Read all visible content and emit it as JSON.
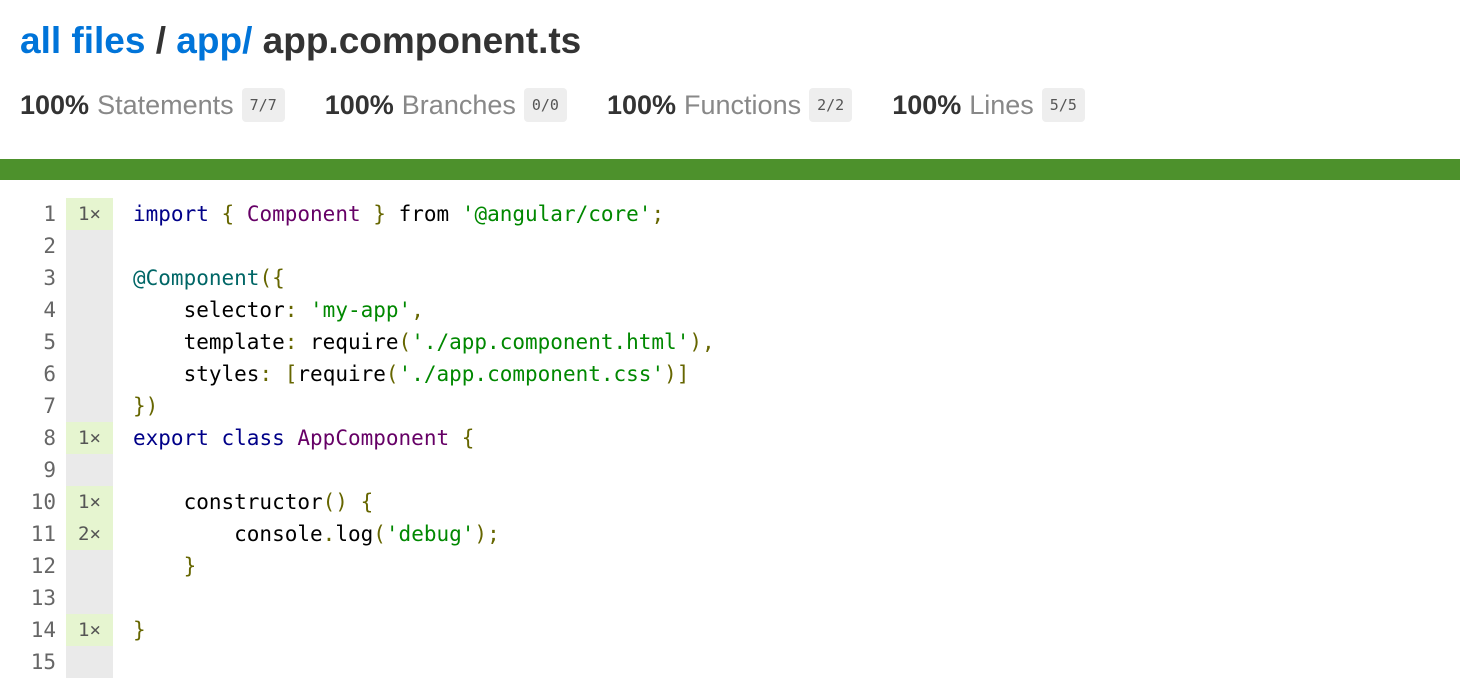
{
  "breadcrumb": {
    "root_link": "all files",
    "separator": "/",
    "folder_link": "app/",
    "file_name": "app.component.ts"
  },
  "stats": [
    {
      "pct": "100%",
      "label": "Statements",
      "fraction": "7/7"
    },
    {
      "pct": "100%",
      "label": "Branches",
      "fraction": "0/0"
    },
    {
      "pct": "100%",
      "label": "Functions",
      "fraction": "2/2"
    },
    {
      "pct": "100%",
      "label": "Lines",
      "fraction": "5/5"
    }
  ],
  "coverage_color": "#4d912c",
  "code_lines": [
    {
      "num": "1",
      "count": "1×",
      "tokens": [
        [
          "kw",
          "import"
        ],
        [
          "id",
          " "
        ],
        [
          "pun",
          "{"
        ],
        [
          "id",
          " "
        ],
        [
          "cls",
          "Component"
        ],
        [
          "id",
          " "
        ],
        [
          "pun",
          "}"
        ],
        [
          "id",
          " from "
        ],
        [
          "str",
          "'@angular/core'"
        ],
        [
          "pun",
          ";"
        ]
      ]
    },
    {
      "num": "2",
      "count": "",
      "tokens": []
    },
    {
      "num": "3",
      "count": "",
      "tokens": [
        [
          "dec",
          "@Component"
        ],
        [
          "pun",
          "({"
        ]
      ]
    },
    {
      "num": "4",
      "count": "",
      "tokens": [
        [
          "id",
          "    selector"
        ],
        [
          "pun",
          ":"
        ],
        [
          "id",
          " "
        ],
        [
          "str",
          "'my-app'"
        ],
        [
          "pun",
          ","
        ]
      ]
    },
    {
      "num": "5",
      "count": "",
      "tokens": [
        [
          "id",
          "    template"
        ],
        [
          "pun",
          ":"
        ],
        [
          "id",
          " require"
        ],
        [
          "pun",
          "("
        ],
        [
          "str",
          "'./app.component.html'"
        ],
        [
          "pun",
          "),"
        ]
      ]
    },
    {
      "num": "6",
      "count": "",
      "tokens": [
        [
          "id",
          "    styles"
        ],
        [
          "pun",
          ":"
        ],
        [
          "id",
          " "
        ],
        [
          "pun",
          "["
        ],
        [
          "id",
          "require"
        ],
        [
          "pun",
          "("
        ],
        [
          "str",
          "'./app.component.css'"
        ],
        [
          "pun",
          ")]"
        ]
      ]
    },
    {
      "num": "7",
      "count": "",
      "tokens": [
        [
          "pun",
          "})"
        ]
      ]
    },
    {
      "num": "8",
      "count": "1×",
      "tokens": [
        [
          "kw",
          "export"
        ],
        [
          "id",
          " "
        ],
        [
          "kw",
          "class"
        ],
        [
          "id",
          " "
        ],
        [
          "cls",
          "AppComponent"
        ],
        [
          "id",
          " "
        ],
        [
          "pun",
          "{"
        ]
      ]
    },
    {
      "num": "9",
      "count": "",
      "tokens": []
    },
    {
      "num": "10",
      "count": "1×",
      "tokens": [
        [
          "id",
          "    constructor"
        ],
        [
          "pun",
          "()"
        ],
        [
          "id",
          " "
        ],
        [
          "pun",
          "{"
        ]
      ]
    },
    {
      "num": "11",
      "count": "2×",
      "tokens": [
        [
          "id",
          "        console"
        ],
        [
          "pun",
          "."
        ],
        [
          "id",
          "log"
        ],
        [
          "pun",
          "("
        ],
        [
          "str",
          "'debug'"
        ],
        [
          "pun",
          ");"
        ]
      ]
    },
    {
      "num": "12",
      "count": "",
      "tokens": [
        [
          "id",
          "    "
        ],
        [
          "pun",
          "}"
        ]
      ]
    },
    {
      "num": "13",
      "count": "",
      "tokens": []
    },
    {
      "num": "14",
      "count": "1×",
      "tokens": [
        [
          "pun",
          "}"
        ]
      ]
    },
    {
      "num": "15",
      "count": "",
      "tokens": []
    }
  ]
}
